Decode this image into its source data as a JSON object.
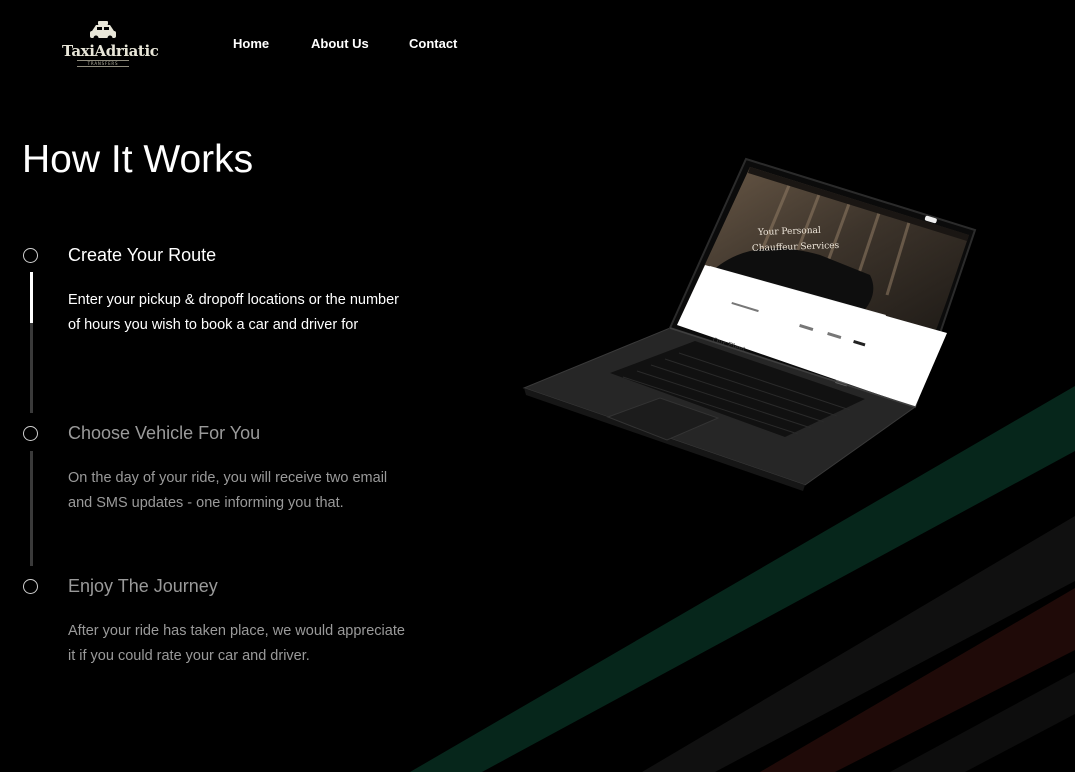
{
  "brand": {
    "name": "TaxiAdriatic",
    "tagline": "TRANSFERS"
  },
  "nav": {
    "items": [
      {
        "label": "Home"
      },
      {
        "label": "About Us"
      },
      {
        "label": "Contact"
      }
    ]
  },
  "main": {
    "title": "How It Works",
    "steps": [
      {
        "title": "Create Your Route",
        "description": "Enter your pickup & dropoff locations or the number of hours you wish to book a car and driver for",
        "state": "active",
        "progress": 0.36
      },
      {
        "title": "Choose Vehicle For You",
        "description": "On the day of your ride, you will receive two email and SMS updates - one informing you that.",
        "state": "inactive",
        "progress": 0
      },
      {
        "title": "Enjoy The Journey",
        "description": "After your ride has taken place, we would appreciate it if you could rate your car and driver.",
        "state": "inactive",
        "progress": 0
      }
    ]
  },
  "laptop_screen": {
    "hero_line1": "Your Personal",
    "hero_line2": "Chauffeur Services",
    "section_heading": "Our Fleet"
  },
  "colors": {
    "background": "#000000",
    "stripe_green": "#06261b",
    "stripe_dark": "#101010",
    "stripe_red": "#1f0a08",
    "text_active": "#ffffff",
    "text_inactive": "#9a9a9a",
    "track": "#3a3a3a"
  }
}
